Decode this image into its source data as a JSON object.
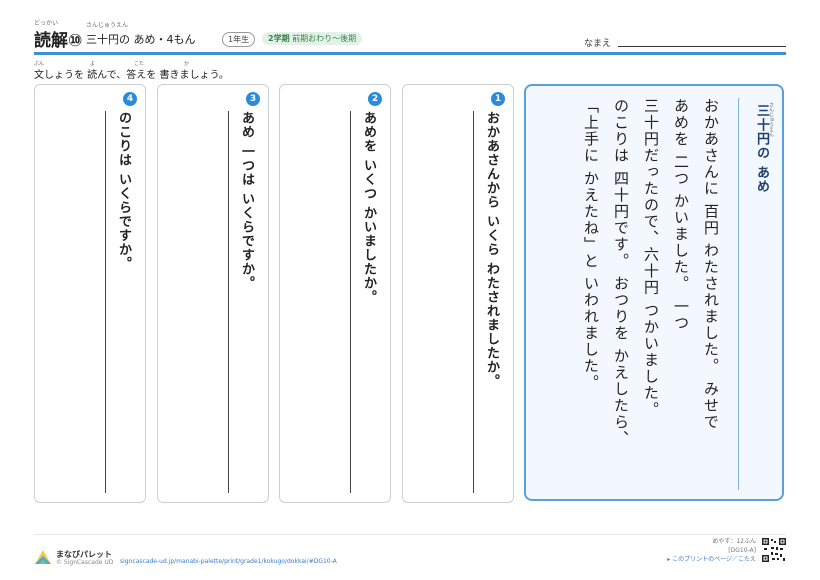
{
  "header": {
    "title_ruby": "どっかい",
    "title": "読解⑩",
    "subtitle_ruby": "さんじゅうえん",
    "subtitle": "三十円の あめ・4もん",
    "grade": "1年生",
    "term_bold": "2学期",
    "term_rest": "前期おわり〜後期",
    "name_label": "なまえ"
  },
  "instruction": {
    "text": "文しょうを 読んで、答えを 書きましょう。",
    "ruby_bun": "ぶん",
    "ruby_yo": "よ",
    "ruby_kota": "こた",
    "ruby_ka": "か"
  },
  "questions": [
    {
      "num": "1",
      "text": "おかあさんから いくら わたされましたか。"
    },
    {
      "num": "2",
      "text": "あめを いくつ かいましたか。"
    },
    {
      "num": "3",
      "text": "あめ 一つは いくらですか。"
    },
    {
      "num": "4",
      "text": "のこりは いくらですか。"
    }
  ],
  "story": {
    "title": "三十円の あめ",
    "title_ruby": "さんじゅうえん",
    "lines": [
      "おかあさんに 百円 わたされました。 みせで",
      "あめを 二つ かいました。 一つ",
      "三十円だったので、六十円 つかいました。",
      "のこりは 四十円です。 おつりを かえしたら、",
      "「上手に かえたね」と いわれました。"
    ]
  },
  "footer": {
    "brand": "まなびパレット",
    "copyright": "© SignCascade UD",
    "url": "signcascade-ud.jp/manabi-palette/print/grade1/kokugo/dokkai/#DG10-A",
    "time": "めやす：12ふん",
    "code": "[DG10-A]",
    "link": "▸ このプリントのページ／こたえ"
  }
}
